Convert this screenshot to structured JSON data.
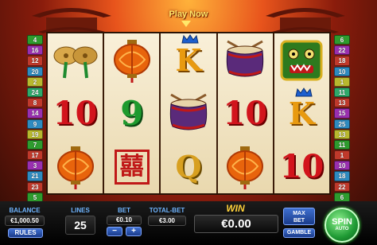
{
  "header": {
    "play_now": "Play Now"
  },
  "paylines": {
    "left": [
      "4",
      "16",
      "12",
      "20",
      "2",
      "24",
      "8",
      "14",
      "9",
      "19",
      "7",
      "17",
      "3",
      "21",
      "23",
      "5"
    ],
    "right": [
      "6",
      "22",
      "18",
      "10",
      "1",
      "11",
      "13",
      "15",
      "25",
      "13",
      "11",
      "1",
      "10",
      "18",
      "22",
      "6"
    ],
    "left_colors": [
      "#2e9c2e",
      "#9a2fb0",
      "#c0392b",
      "#2e8bc0",
      "#b8b82e",
      "#2eaa6a",
      "#c0392b",
      "#9a2fb0",
      "#2e8bc0",
      "#b8b82e",
      "#2e9c2e",
      "#c0392b",
      "#9a2fb0",
      "#2e8bc0",
      "#c0392b",
      "#2e9c2e"
    ],
    "right_colors": [
      "#2e9c2e",
      "#9a2fb0",
      "#c0392b",
      "#2e8bc0",
      "#b8b82e",
      "#2eaa6a",
      "#c0392b",
      "#9a2fb0",
      "#2e8bc0",
      "#b8b82e",
      "#2e9c2e",
      "#c0392b",
      "#9a2fb0",
      "#2e8bc0",
      "#c0392b",
      "#2e9c2e"
    ]
  },
  "reels": [
    [
      "cymbals",
      "10",
      "lantern"
    ],
    [
      "lantern",
      "9",
      "double-happiness"
    ],
    [
      "K",
      "drum",
      "Q"
    ],
    [
      "drum",
      "10",
      "lantern"
    ],
    [
      "lion-head",
      "K",
      "10"
    ]
  ],
  "symbol_text": {
    "ten": "10",
    "nine": "9",
    "king": "K",
    "queen": "Q",
    "happiness": "囍"
  },
  "panel": {
    "balance_label": "BALANCE",
    "balance_value": "€1,000.50",
    "rules_label": "RULES",
    "lines_label": "LINES",
    "lines_value": "25",
    "bet_label": "BET",
    "bet_value": "€0.10",
    "bet_minus": "−",
    "bet_plus": "+",
    "total_bet_label": "TOTAL-BET",
    "total_bet_value": "€3.00",
    "win_label": "WIN",
    "win_value": "€0.00",
    "max_bet_label": "MAX\nBET",
    "gamble_label": "GAMBLE",
    "spin_label": "SPIN",
    "auto_label": "AUTO"
  },
  "colors": {
    "ten": "#d2141c",
    "nine": "#1e9a2e",
    "king": "#e89a10",
    "queen": "#d8a020",
    "accent_blue": "#6fb5ff",
    "win_gold": "#ffd23a"
  }
}
